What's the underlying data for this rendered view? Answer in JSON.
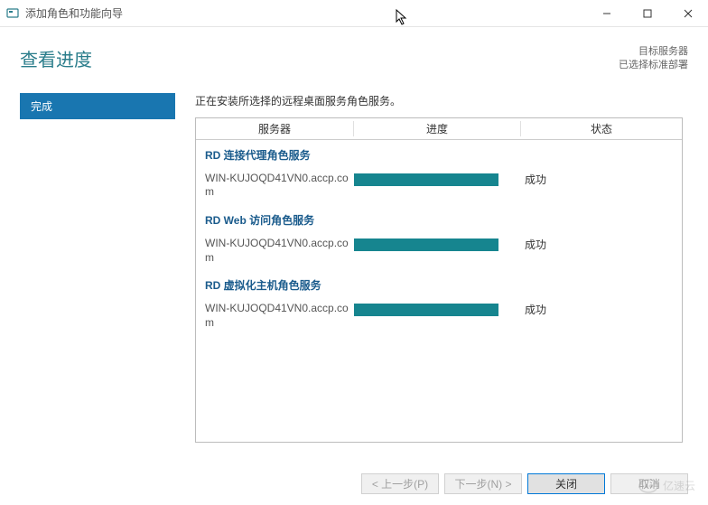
{
  "window": {
    "title": "添加角色和功能向导"
  },
  "header": {
    "page_title": "查看进度",
    "target_label": "目标服务器",
    "target_value": "已选择标准部署"
  },
  "sidebar": {
    "items": [
      {
        "label": "完成"
      }
    ]
  },
  "main": {
    "install_msg": "正在安装所选择的远程桌面服务角色服务。",
    "columns": {
      "server": "服务器",
      "progress": "进度",
      "status": "状态"
    },
    "groups": [
      {
        "title": "RD 连接代理角色服务",
        "server": "WIN-KUJOQD41VN0.accp.com",
        "status": "成功",
        "progress_pct": 100
      },
      {
        "title": "RD Web 访问角色服务",
        "server": "WIN-KUJOQD41VN0.accp.com",
        "status": "成功",
        "progress_pct": 100
      },
      {
        "title": "RD 虚拟化主机角色服务",
        "server": "WIN-KUJOQD41VN0.accp.com",
        "status": "成功",
        "progress_pct": 100
      }
    ]
  },
  "footer": {
    "prev": "< 上一步(P)",
    "next": "下一步(N) >",
    "close": "关闭",
    "cancel": "取消"
  },
  "watermark": "亿速云"
}
